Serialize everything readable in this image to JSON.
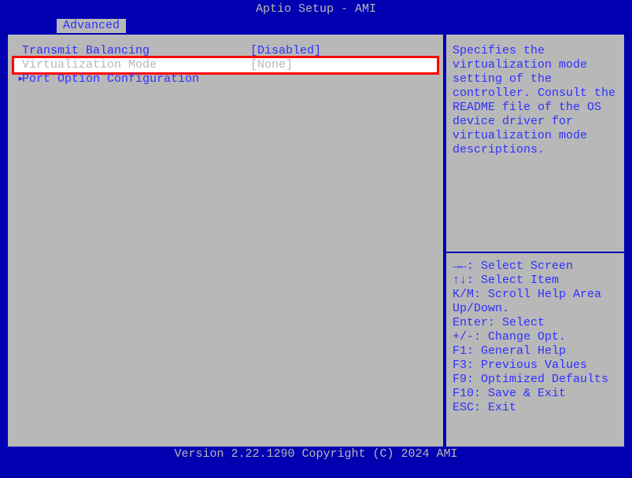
{
  "title": "Aptio Setup - AMI",
  "tab": "Advanced",
  "items": [
    {
      "label": "Transmit Balancing",
      "value": "[Disabled]"
    },
    {
      "label": "Virtualization Mode",
      "value": "[None]"
    },
    {
      "label": "Port Option Configuration",
      "value": ""
    }
  ],
  "help": "Specifies the virtualization mode setting of the controller. Consult the README file of the OS device driver for virtualization mode descriptions.",
  "nav": {
    "l1": "→←: Select Screen",
    "l2": "↑↓: Select Item",
    "l3": "K/M: Scroll Help Area Up/Down.",
    "l4": "Enter: Select",
    "l5": "+/-: Change Opt.",
    "l6": "F1: General Help",
    "l7": "F3: Previous Values",
    "l8": "F9: Optimized Defaults",
    "l9": "F10: Save & Exit",
    "l10": "ESC: Exit"
  },
  "footer": "Version 2.22.1290 Copyright (C) 2024 AMI"
}
